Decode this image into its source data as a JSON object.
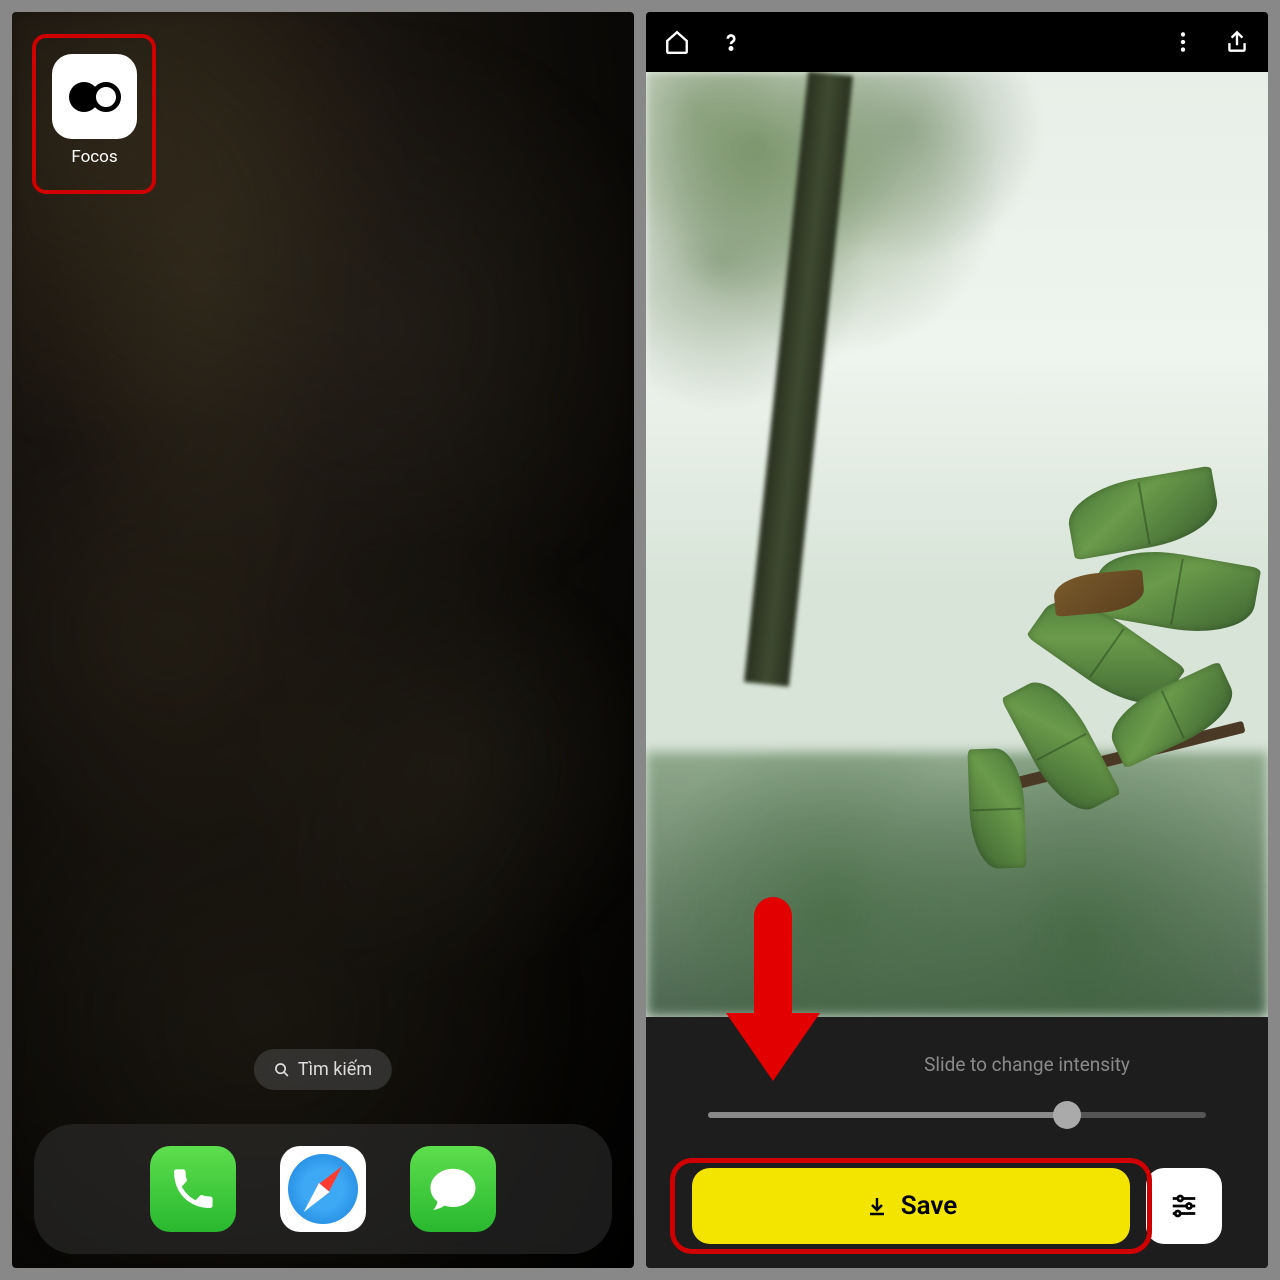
{
  "left": {
    "app": {
      "name": "Focos"
    },
    "search": {
      "label": "Tìm kiếm"
    },
    "dock": {
      "items": [
        "phone",
        "safari",
        "messages"
      ]
    }
  },
  "right": {
    "toolbar": {
      "home_icon": "home-icon",
      "help_icon": "help-icon",
      "more_icon": "more-icon",
      "share_icon": "share-icon"
    },
    "slider": {
      "label": "Slide to change intensity",
      "value_percent": 72
    },
    "save": {
      "label": "Save"
    }
  }
}
